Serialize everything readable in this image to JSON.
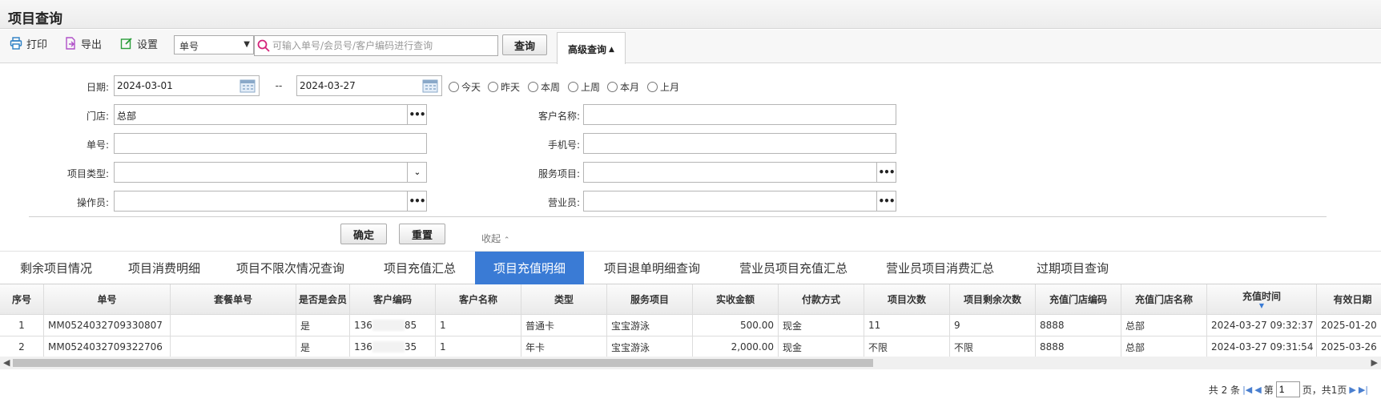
{
  "page": {
    "title": "项目查询"
  },
  "toolbar": {
    "print_label": "打印",
    "export_label": "导出",
    "settings_label": "设置",
    "search_type": "单号",
    "search_placeholder": "可输入单号/会员号/客户编码进行查询",
    "query_label": "查询",
    "advanced_label": "高级查询"
  },
  "filters": {
    "date_label": "日期:",
    "date_from": "2024-03-01",
    "date_sep": "--",
    "date_to": "2024-03-27",
    "quick_dates": [
      "今天",
      "昨天",
      "本周",
      "上周",
      "本月",
      "上月"
    ],
    "store_label": "门店:",
    "store_value": "总部",
    "customer_name_label": "客户名称:",
    "order_label": "单号:",
    "phone_label": "手机号:",
    "item_type_label": "项目类型:",
    "service_item_label": "服务项目:",
    "operator_label": "操作员:",
    "salesperson_label": "营业员:",
    "confirm_label": "确定",
    "reset_label": "重置",
    "collapse_label": "收起"
  },
  "tabs": [
    {
      "label": "剩余项目情况",
      "active": false
    },
    {
      "label": "项目消费明细",
      "active": false
    },
    {
      "label": "项目不限次情况查询",
      "active": false
    },
    {
      "label": "项目充值汇总",
      "active": false
    },
    {
      "label": "项目充值明细",
      "active": true
    },
    {
      "label": "项目退单明细查询",
      "active": false
    },
    {
      "label": "营业员项目充值汇总",
      "active": false
    },
    {
      "label": "营业员项目消费汇总",
      "active": false
    },
    {
      "label": "过期项目查询",
      "active": false
    }
  ],
  "table": {
    "headers": [
      "序号",
      "单号",
      "套餐单号",
      "是否是会员",
      "客户编码",
      "客户名称",
      "类型",
      "服务项目",
      "实收金额",
      "付款方式",
      "项目次数",
      "项目剩余次数",
      "充值门店编码",
      "充值门店名称",
      "充值时间",
      "有效日期"
    ],
    "rows": [
      [
        "1",
        "MM0524032709330807",
        "",
        "是",
        "136",
        "85",
        "1",
        "普通卡",
        "宝宝游泳",
        "500.00",
        "现金",
        "11",
        "9",
        "8888",
        "总部",
        "2024-03-27 09:32:37",
        "2025-01-20"
      ],
      [
        "2",
        "MM0524032709322706",
        "",
        "是",
        "136",
        "35",
        "1",
        "年卡",
        "宝宝游泳",
        "2,000.00",
        "现金",
        "不限",
        "不限",
        "8888",
        "总部",
        "2024-03-27 09:31:54",
        "2025-03-26"
      ]
    ]
  },
  "pager": {
    "total_text": "共 2 条",
    "page_prefix": "第",
    "page_value": "1",
    "page_suffix": "页，共1页"
  },
  "colors": {
    "active_tab": "#3a7bd5",
    "icon": "#2a9d3a",
    "search_icon": "#d4237a"
  }
}
